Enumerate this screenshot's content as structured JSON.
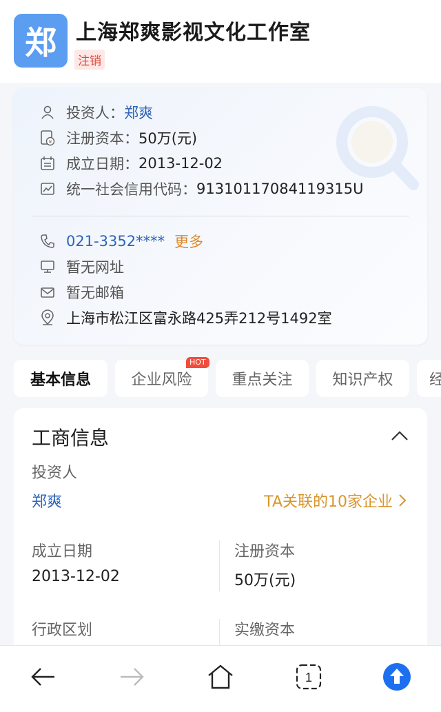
{
  "company": {
    "logo_char": "郑",
    "name": "上海郑爽影视文化工作室",
    "status": "注销"
  },
  "info": {
    "investor_label": "投资人：",
    "investor_value": "郑爽",
    "capital_label": "注册资本：",
    "capital_value": "50万(元)",
    "founded_label": "成立日期：",
    "founded_value": "2013-12-02",
    "credit_code_label": "统一社会信用代码：",
    "credit_code_value": "91310117084119315U",
    "phone": "021-3352****",
    "phone_more": "更多",
    "website": "暂无网址",
    "email": "暂无邮箱",
    "address": "上海市松江区富永路425弄212号1492室"
  },
  "tabs": [
    {
      "label": "基本信息",
      "active": true
    },
    {
      "label": "企业风险",
      "active": false,
      "badge": "HOT"
    },
    {
      "label": "重点关注",
      "active": false
    },
    {
      "label": "知识产权",
      "active": false
    },
    {
      "label": "经",
      "active": false
    }
  ],
  "business_info": {
    "title": "工商信息",
    "investor_label": "投资人",
    "investor_value": "郑爽",
    "related_link": "TA关联的10家企业",
    "founded_label": "成立日期",
    "founded_value": "2013-12-02",
    "capital_label": "注册资本",
    "capital_value": "50万(元)",
    "region_label": "行政区划",
    "paid_capital_label": "实缴资本"
  },
  "bottom_nav": {
    "back_icon": "arrow-left-icon",
    "forward_icon": "arrow-right-icon",
    "home_icon": "home-icon",
    "tabs_count": "1",
    "up_icon": "arrow-up-circle-icon"
  },
  "colors": {
    "accent_blue": "#2e64b8",
    "logo_blue": "#5b9df0",
    "status_red": "#e1473a",
    "more_orange": "#e0892c",
    "related_gold": "#d9952e",
    "up_button_blue": "#1e6ff0"
  }
}
